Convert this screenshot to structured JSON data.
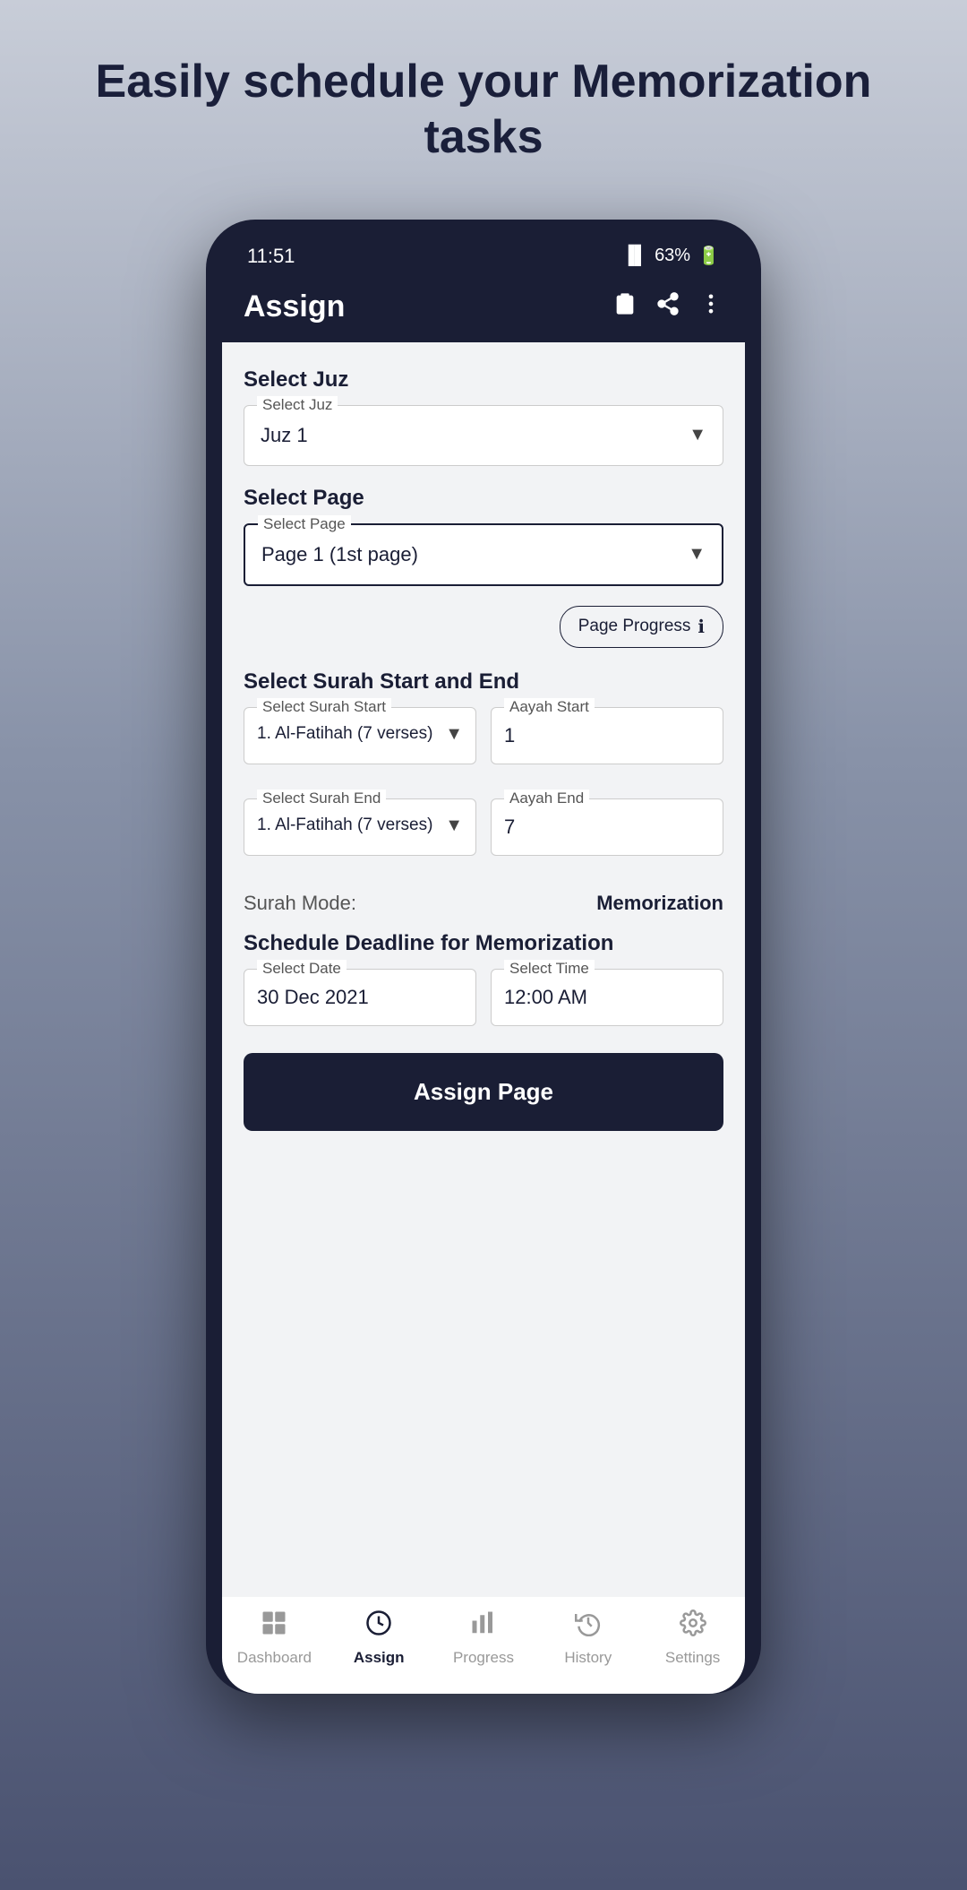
{
  "page": {
    "headline": "Easily schedule your Memorization tasks"
  },
  "status_bar": {
    "time": "11:51",
    "signal": "VoLTE",
    "battery": "63%"
  },
  "header": {
    "title": "Assign",
    "icons": [
      "clipboard",
      "share",
      "more-vertical"
    ]
  },
  "form": {
    "select_juz": {
      "section_label": "Select Juz",
      "field_label": "Select Juz",
      "value": "Juz 1"
    },
    "select_page": {
      "section_label": "Select Page",
      "field_label": "Select Page",
      "value": "Page 1 (1st page)"
    },
    "page_progress_btn": "Page Progress",
    "select_surah": {
      "section_label": "Select Surah Start and End",
      "surah_start_label": "Select Surah Start",
      "surah_start_value": "1. Al-Fatihah (7 verses)",
      "aayah_start_label": "Aayah Start",
      "aayah_start_value": "1",
      "surah_end_label": "Select Surah End",
      "surah_end_value": "1. Al-Fatihah (7 verses)",
      "aayah_end_label": "Aayah End",
      "aayah_end_value": "7"
    },
    "surah_mode": {
      "label": "Surah Mode:",
      "value": "Memorization"
    },
    "schedule": {
      "section_label": "Schedule Deadline for Memorization",
      "date_label": "Select Date",
      "date_value": "30 Dec 2021",
      "time_label": "Select Time",
      "time_value": "12:00 AM"
    },
    "assign_page_btn": "Assign Page"
  },
  "bottom_nav": {
    "items": [
      {
        "label": "Dashboard",
        "icon": "grid",
        "active": false
      },
      {
        "label": "Assign",
        "icon": "clock-outline",
        "active": true
      },
      {
        "label": "Progress",
        "icon": "bar-chart",
        "active": false
      },
      {
        "label": "History",
        "icon": "history",
        "active": false
      },
      {
        "label": "Settings",
        "icon": "gear",
        "active": false
      }
    ]
  }
}
